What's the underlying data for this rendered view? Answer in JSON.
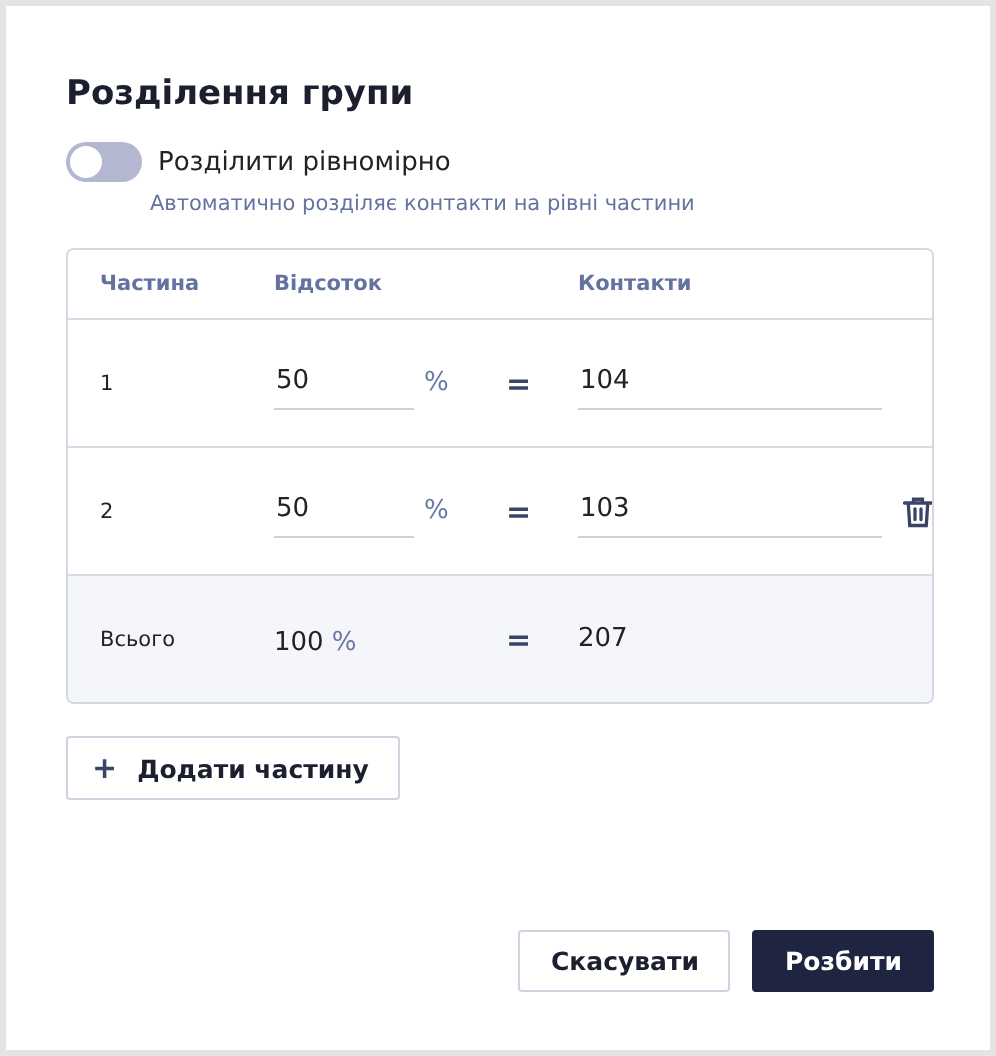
{
  "title": "Розділення групи",
  "toggle": {
    "label": "Розділити рівномірно",
    "on": false,
    "hint": "Автоматично розділяє контакти на рівні частини"
  },
  "table": {
    "columns": [
      "Частина",
      "Відсоток",
      "Контакти"
    ],
    "rows": [
      {
        "part": "1",
        "percent": "50",
        "unit": "%",
        "equals": "=",
        "contacts": "104",
        "removable": false
      },
      {
        "part": "2",
        "percent": "50",
        "unit": "%",
        "equals": "=",
        "contacts": "103",
        "removable": true
      }
    ],
    "total": {
      "label": "Всього",
      "percent": "100",
      "unit": "%",
      "equals": "=",
      "contacts": "207"
    }
  },
  "add_button": {
    "icon": "+",
    "label": "Додати частину"
  },
  "buttons": {
    "cancel": "Скасувати",
    "confirm": "Розбити"
  }
}
